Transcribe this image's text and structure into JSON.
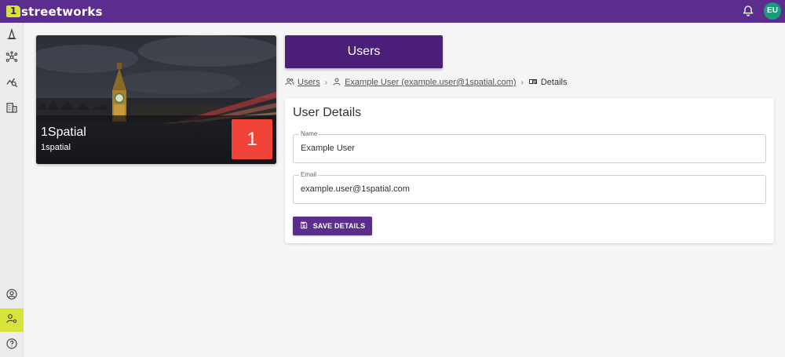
{
  "app": {
    "logo_mark": "1",
    "logo_text": "streetworks",
    "avatar_initials": "EU",
    "icons": {
      "notifications": "bell-icon",
      "rail": [
        "cone-icon",
        "network-icon",
        "chart-search-icon",
        "building-icon",
        "user-circle-icon",
        "user-settings-icon",
        "help-icon"
      ]
    }
  },
  "colors": {
    "brand": "#5b2d8e",
    "brand_dark": "#4b1f79",
    "accent": "#d8e33a",
    "badge": "#f04438"
  },
  "org_card": {
    "name": "1Spatial",
    "subtitle": "1spatial",
    "badge": "1"
  },
  "header": {
    "users_label": "Users"
  },
  "breadcrumb": {
    "items": [
      {
        "label": "Users",
        "icon": "users-icon"
      },
      {
        "label": "Example User (example.user@1spatial.com)",
        "icon": "user-icon"
      },
      {
        "label": "Details",
        "icon": "id-card-icon"
      }
    ],
    "separator": "›"
  },
  "details": {
    "title": "User Details",
    "name_label": "Name",
    "name_value": "Example User",
    "email_label": "Email",
    "email_value": "example.user@1spatial.com",
    "save_label": "SAVE DETAILS"
  }
}
